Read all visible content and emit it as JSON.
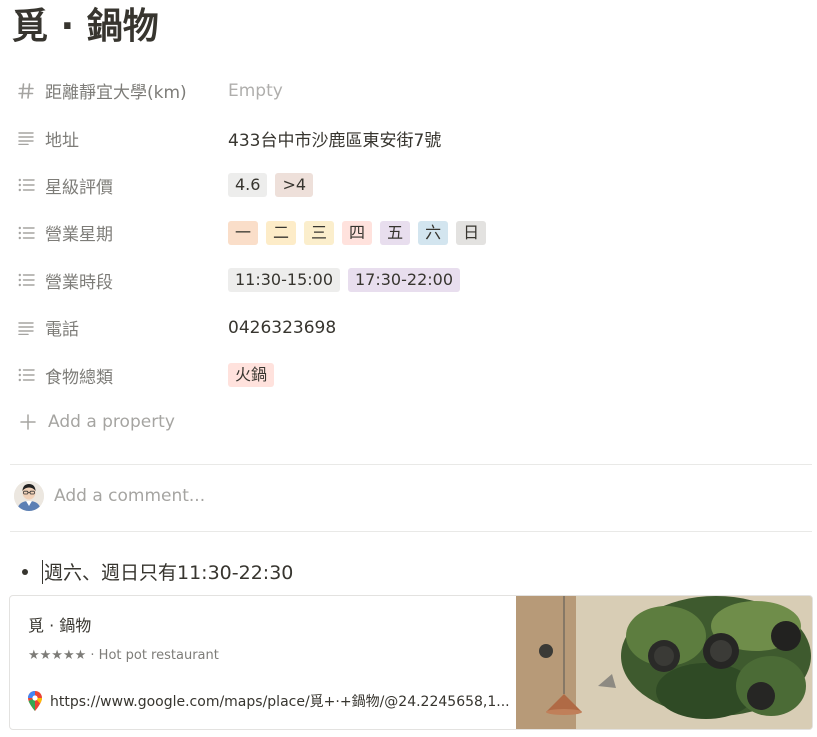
{
  "page": {
    "title": "覓 · 鍋物"
  },
  "properties": [
    {
      "key": "distance",
      "icon": "hash-icon",
      "name": "距離靜宜大學(km)",
      "kind": "empty",
      "value": "Empty"
    },
    {
      "key": "address",
      "icon": "text-lines-icon",
      "name": "地址",
      "kind": "text",
      "value": "433台中市沙鹿區東安街7號"
    },
    {
      "key": "rating",
      "icon": "list-icon",
      "name": "星級評價",
      "kind": "tags",
      "tags": [
        {
          "label": "4.6",
          "color": "#ededec"
        },
        {
          "label": ">4",
          "color": "#eee0da"
        }
      ]
    },
    {
      "key": "days",
      "icon": "list-icon",
      "name": "營業星期",
      "kind": "tags",
      "tags": [
        {
          "label": "一",
          "color": "#fadec9"
        },
        {
          "label": "二",
          "color": "#fdecc8"
        },
        {
          "label": "三",
          "color": "#fbeecc"
        },
        {
          "label": "四",
          "color": "#ffe2dd"
        },
        {
          "label": "五",
          "color": "#e8deee"
        },
        {
          "label": "六",
          "color": "#d3e5ef"
        },
        {
          "label": "日",
          "color": "#e3e2e0"
        }
      ]
    },
    {
      "key": "hours",
      "icon": "list-icon",
      "name": "營業時段",
      "kind": "tags",
      "tags": [
        {
          "label": "11:30-15:00",
          "color": "#ededec"
        },
        {
          "label": "17:30-22:00",
          "color": "#e8deee"
        }
      ]
    },
    {
      "key": "phone",
      "icon": "text-lines-icon",
      "name": "電話",
      "kind": "text",
      "value": "0426323698"
    },
    {
      "key": "food",
      "icon": "list-icon",
      "name": "食物總類",
      "kind": "tags",
      "tags": [
        {
          "label": "火鍋",
          "color": "#ffe2dd"
        }
      ]
    }
  ],
  "add_property": {
    "label": "Add a property",
    "icon": "plus-icon"
  },
  "comment": {
    "placeholder": "Add a comment..."
  },
  "body": {
    "bullet_text": "週六、週日只有11:30-22:30"
  },
  "bookmark": {
    "title": "覓 · 鍋物",
    "description": "★★★★★ · Hot pot restaurant",
    "url": "https://www.google.com/maps/place/覓+·+鍋物/@24.2245658,1...",
    "icon": "google-maps-pin-icon"
  },
  "colors": {
    "text": "#37352f",
    "muted": "rgba(55,53,47,0.65)",
    "divider": "#e9e9e7"
  }
}
